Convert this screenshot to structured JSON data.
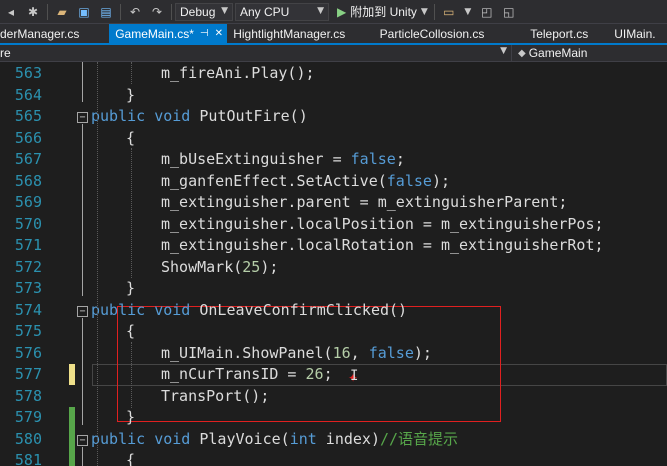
{
  "toolbar": {
    "config": "Debug",
    "platform": "Any CPU",
    "attach_label": "附加到 Unity",
    "icons": [
      "nav-back-icon",
      "settings-icon",
      "open-folder-icon",
      "save-icon",
      "save-all-icon",
      "undo-icon",
      "redo-icon",
      "play-icon",
      "browser-icon",
      "tool-icon"
    ]
  },
  "tabs": [
    {
      "label": "derManager.cs",
      "active": false
    },
    {
      "label": "GameMain.cs*",
      "active": true
    },
    {
      "label": "HightlightManager.cs",
      "active": false
    },
    {
      "label": "ParticleCollosion.cs",
      "active": false
    },
    {
      "label": "Teleport.cs",
      "active": false
    },
    {
      "label": "UIMain.",
      "active": false
    }
  ],
  "navbar": {
    "left": "re",
    "right": "GameMain"
  },
  "editor": {
    "lines": [
      {
        "n": "563",
        "tokens": [
          [
            "id",
            "m_fireAni.Play();"
          ]
        ]
      },
      {
        "n": "564",
        "tokens": [
          [
            "id",
            "}"
          ]
        ]
      },
      {
        "n": "565",
        "tokens": [
          [
            "kw",
            "public"
          ],
          [
            "id",
            " "
          ],
          [
            "kw",
            "void"
          ],
          [
            "id",
            " PutOutFire()"
          ]
        ]
      },
      {
        "n": "566",
        "tokens": [
          [
            "id",
            "{"
          ]
        ]
      },
      {
        "n": "567",
        "tokens": [
          [
            "id",
            "m_bUseExtinguisher = "
          ],
          [
            "kw",
            "false"
          ],
          [
            "id",
            ";"
          ]
        ]
      },
      {
        "n": "568",
        "tokens": [
          [
            "id",
            "m_ganfenEffect.SetActive("
          ],
          [
            "kw",
            "false"
          ],
          [
            "id",
            ");"
          ]
        ]
      },
      {
        "n": "569",
        "tokens": [
          [
            "id",
            "m_extinguisher.parent = m_extinguisherParent;"
          ]
        ]
      },
      {
        "n": "570",
        "tokens": [
          [
            "id",
            "m_extinguisher.localPosition = m_extinguisherPos;"
          ]
        ]
      },
      {
        "n": "571",
        "tokens": [
          [
            "id",
            "m_extinguisher.localRotation = m_extinguisherRot;"
          ]
        ]
      },
      {
        "n": "572",
        "tokens": [
          [
            "id",
            "ShowMark("
          ],
          [
            "num",
            "25"
          ],
          [
            "id",
            ");"
          ]
        ]
      },
      {
        "n": "573",
        "tokens": [
          [
            "id",
            "}"
          ]
        ]
      },
      {
        "n": "574",
        "tokens": [
          [
            "kw",
            "public"
          ],
          [
            "id",
            " "
          ],
          [
            "kw",
            "void"
          ],
          [
            "id",
            " OnLeaveConfirmClicked()"
          ]
        ]
      },
      {
        "n": "575",
        "tokens": [
          [
            "id",
            "{"
          ]
        ]
      },
      {
        "n": "576",
        "tokens": [
          [
            "id",
            "m_UIMain.ShowPanel("
          ],
          [
            "num",
            "16"
          ],
          [
            "id",
            ", "
          ],
          [
            "kw",
            "false"
          ],
          [
            "id",
            ");"
          ]
        ]
      },
      {
        "n": "577",
        "tokens": [
          [
            "id",
            "m_nCurTransID = "
          ],
          [
            "num",
            "26"
          ],
          [
            "id",
            ";"
          ]
        ]
      },
      {
        "n": "578",
        "tokens": [
          [
            "id",
            "TransPort();"
          ]
        ]
      },
      {
        "n": "579",
        "tokens": [
          [
            "id",
            "}"
          ]
        ]
      },
      {
        "n": "580",
        "tokens": [
          [
            "kw",
            "public"
          ],
          [
            "id",
            " "
          ],
          [
            "kw",
            "void"
          ],
          [
            "id",
            " PlayVoice("
          ],
          [
            "kw",
            "int"
          ],
          [
            "id",
            " index)"
          ],
          [
            "cm",
            "//语音提示"
          ]
        ]
      },
      {
        "n": "581",
        "tokens": [
          [
            "id",
            "{"
          ]
        ]
      }
    ]
  }
}
